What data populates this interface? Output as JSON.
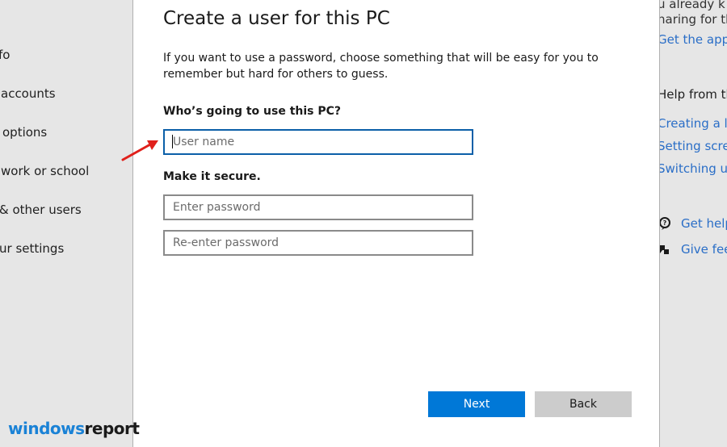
{
  "sidebar": {
    "items": [
      {
        "label": "fo"
      },
      {
        "label": "accounts"
      },
      {
        "label": "options"
      },
      {
        "label": "work or school"
      },
      {
        "label": "& other users"
      },
      {
        "label": "ur settings"
      }
    ]
  },
  "right_panel": {
    "text_top_1": "u already k",
    "text_top_2": "haring for th",
    "get_app_link": "Get the app",
    "help_heading": "Help from the",
    "links": [
      "Creating a loc",
      "Setting screen",
      "Switching use"
    ],
    "get_help": "Get help",
    "give_feedback": "Give feed"
  },
  "dialog": {
    "title": "Create a user for this PC",
    "description": "If you want to use a password, choose something that will be easy for you to remember but hard for others to guess.",
    "who_label": "Who’s going to use this PC?",
    "username_placeholder": "User name",
    "username_value": "",
    "secure_label": "Make it secure.",
    "password_placeholder": "Enter password",
    "reenter_placeholder": "Re-enter password",
    "next_label": "Next",
    "back_label": "Back"
  },
  "watermark": {
    "part1": "windows",
    "part2": "report"
  },
  "colors": {
    "accent": "#0078d7",
    "link": "#2a6ec7",
    "annotation_arrow": "#e0201b",
    "focus_border": "#0b5fa8"
  },
  "icons": [
    "help-icon",
    "feedback-icon",
    "red-arrow-icon"
  ]
}
